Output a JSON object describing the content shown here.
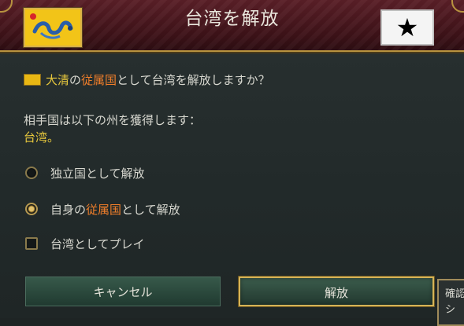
{
  "dialog": {
    "title": "台湾を解放",
    "prompt": {
      "overlord": "大清",
      "particle1": "の",
      "subject_type": "従属国",
      "rest": "として台湾を解放しますか？"
    },
    "gain_label": "相手国は以下の州を獲得します：",
    "gain_province": "台湾。",
    "options": [
      {
        "label": "独立国として解放",
        "checked": false
      },
      {
        "label_prefix": "自身の",
        "label_highlight": "従属国",
        "label_suffix": "として解放",
        "checked": true
      },
      {
        "label": "台湾としてプレイ",
        "checked": false
      }
    ],
    "buttons": {
      "cancel": "キャンセル",
      "confirm": "解放"
    },
    "side_panel_text": [
      "確認",
      "シ"
    ]
  },
  "colors": {
    "header": "#5a1f27",
    "gold": "#e7c83d",
    "orange": "#f07e2a",
    "border_gold": "#d5b357",
    "button_green": "#2d4a3d",
    "flag_qing": "#f2c418"
  },
  "icons": {
    "left_flag": "qing-dragon-flag-icon",
    "right_flag": "black-star-flag-icon"
  }
}
